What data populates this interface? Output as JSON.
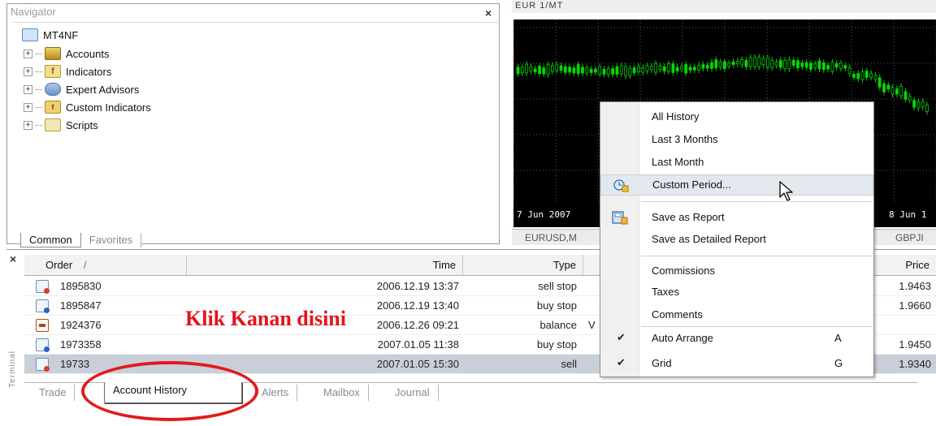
{
  "navigator": {
    "title": "Navigator",
    "close_label": "×",
    "root": "MT4NF",
    "items": [
      {
        "label": "Accounts",
        "icon": "accounts-icon"
      },
      {
        "label": "Indicators",
        "icon": "indicators-icon"
      },
      {
        "label": "Expert Advisors",
        "icon": "expert-advisors-icon"
      },
      {
        "label": "Custom Indicators",
        "icon": "custom-indicators-icon"
      },
      {
        "label": "Scripts",
        "icon": "scripts-icon"
      }
    ],
    "tabs": [
      "Common",
      "Favorites"
    ]
  },
  "chart": {
    "header_text": "EUR 1/MT",
    "dates": [
      "7 Jun 2007",
      "8 Jun 1"
    ],
    "tabs": [
      "EURUSD,M",
      "GBPJI"
    ]
  },
  "terminal": {
    "close_label": "×",
    "side_label": "Terminal",
    "columns": [
      "Order",
      "Time",
      "Type",
      "Price"
    ],
    "rows": [
      {
        "order": "1895830",
        "time": "2006.12.19 13:37",
        "type": "sell stop",
        "price": "1.9463",
        "icon": "sell-order-icon",
        "selected": false
      },
      {
        "order": "1895847",
        "time": "2006.12.19 13:40",
        "type": "buy stop",
        "price": "1.9660",
        "icon": "buy-order-icon",
        "selected": false
      },
      {
        "order": "1924376",
        "time": "2006.12.26 09:21",
        "type": "balance",
        "price": "",
        "icon": "balance-icon",
        "selected": false,
        "extra": "V"
      },
      {
        "order": "1973358",
        "time": "2007.01.05 11:38",
        "type": "buy stop",
        "price": "1.9450",
        "icon": "buy-order-icon",
        "selected": false
      },
      {
        "order": "19733",
        "time": "2007.01.05 15:30",
        "type": "sell",
        "price": "1.9340",
        "icon": "sell-order-icon",
        "selected": true
      }
    ],
    "tabs": [
      "Trade",
      "Account History",
      "Alerts",
      "Mailbox",
      "Journal"
    ],
    "active_tab": "Account History"
  },
  "context_menu": {
    "items": [
      {
        "label": "All History"
      },
      {
        "label": "Last 3 Months"
      },
      {
        "label": "Last Month"
      },
      {
        "label": "Custom Period...",
        "icon": "calendar-icon",
        "hover": true
      },
      {
        "label": "Save as Report",
        "icon": "save-report-icon"
      },
      {
        "label": "Save as Detailed Report"
      },
      {
        "label": "Commissions"
      },
      {
        "label": "Taxes"
      },
      {
        "label": "Comments"
      },
      {
        "label": "Auto Arrange",
        "checked": true,
        "shortcut": "A"
      },
      {
        "label": "Grid",
        "checked": true,
        "shortcut": "G"
      }
    ]
  },
  "annotation": {
    "text": "Klik Kanan disini",
    "color": "#e4131b"
  }
}
